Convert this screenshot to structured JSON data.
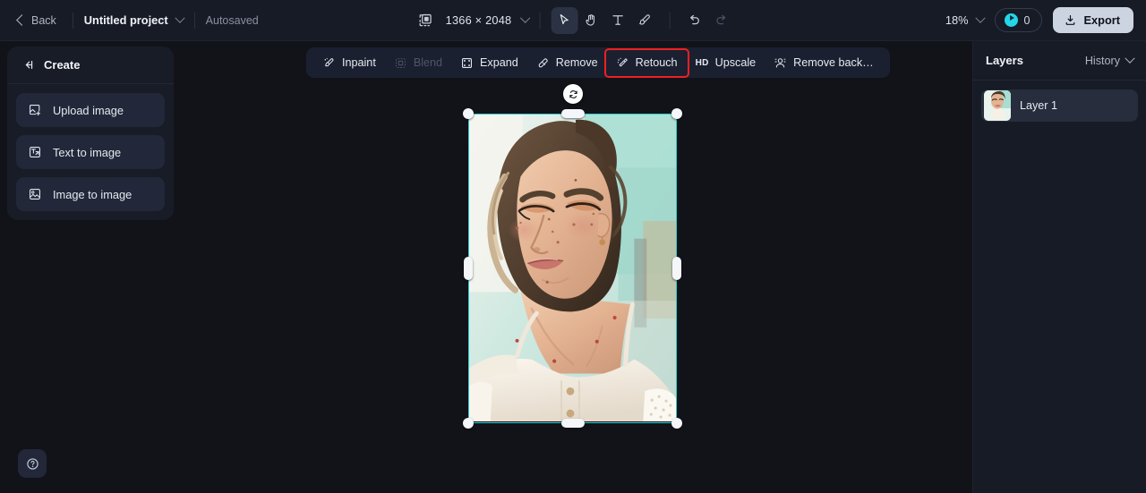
{
  "topbar": {
    "back_label": "Back",
    "project_name": "Untitled project",
    "autosaved_label": "Autosaved",
    "canvas_size": "1366 × 2048",
    "zoom_level": "18%",
    "credits_count": "0",
    "export_label": "Export",
    "tools": [
      {
        "name": "select-tool",
        "icon": "cursor-arrow-icon",
        "active": true
      },
      {
        "name": "hand-tool",
        "icon": "hand-icon",
        "active": false
      },
      {
        "name": "text-tool",
        "icon": "text-icon",
        "active": false
      },
      {
        "name": "brush-tool",
        "icon": "brush-icon",
        "active": false
      }
    ],
    "undo_icon": "undo-icon",
    "redo_icon": "redo-icon",
    "resize-canvas_icon": "resize-canvas-icon"
  },
  "left_panel": {
    "title": "Create",
    "collapse_icon": "collapse-panel-icon",
    "items": [
      {
        "label": "Upload image",
        "icon": "upload-image-icon"
      },
      {
        "label": "Text to image",
        "icon": "text-to-image-icon"
      },
      {
        "label": "Image to image",
        "icon": "image-to-image-icon"
      }
    ]
  },
  "float_toolbar": {
    "items": [
      {
        "label": "Inpaint",
        "icon": "inpaint-brush-icon",
        "disabled": false,
        "highlighted": false
      },
      {
        "label": "Blend",
        "icon": "blend-icon",
        "disabled": true,
        "highlighted": false
      },
      {
        "label": "Expand",
        "icon": "expand-icon",
        "disabled": false,
        "highlighted": false
      },
      {
        "label": "Remove",
        "icon": "eraser-icon",
        "disabled": false,
        "highlighted": false
      },
      {
        "label": "Retouch",
        "icon": "magic-wand-icon",
        "disabled": false,
        "highlighted": true
      },
      {
        "label": "Upscale",
        "icon": "hd-icon",
        "disabled": false,
        "highlighted": false
      },
      {
        "label": "Remove back…",
        "icon": "remove-background-icon",
        "disabled": false,
        "highlighted": false
      }
    ]
  },
  "right_panel": {
    "title": "Layers",
    "history_label": "History",
    "layers": [
      {
        "name": "Layer 1"
      }
    ]
  },
  "canvas": {
    "rotate_handle_icon": "rotate-icon",
    "selection_color": "#2ecfd0"
  },
  "help": {
    "icon": "question-mark-icon"
  },
  "colors": {
    "accent_cyan": "#25d5e8",
    "selection": "#2ecfd0",
    "highlight_red": "#ee2020",
    "topbar_bg": "#171b26",
    "canvas_bg": "#121319",
    "panel_bg": "#181c27"
  }
}
